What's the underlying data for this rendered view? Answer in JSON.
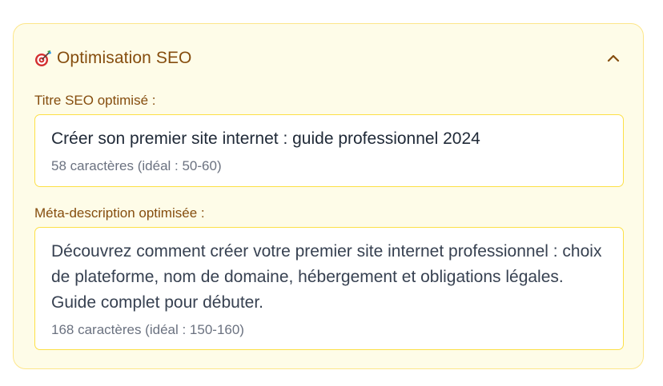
{
  "section": {
    "icon": "target-dart-icon",
    "title": "Optimisation SEO",
    "collapse_icon": "chevron-up-icon"
  },
  "seo_title": {
    "label": "Titre SEO optimisé :",
    "value": "Créer son premier site internet : guide professionnel 2024",
    "count_text": "58 caractères (idéal : 50-60)"
  },
  "meta_description": {
    "label": "Méta-description optimisée :",
    "value": "Découvrez comment créer votre premier site internet professionnel : choix de plateforme, nom de domaine, hébergement et obligations légales. Guide complet pour débuter.",
    "count_text": "168 caractères (idéal : 150-160)"
  },
  "colors": {
    "panel_bg": "#fefce8",
    "panel_border": "#fde68a",
    "accent_text": "#854d0e",
    "field_border": "#fde047"
  }
}
